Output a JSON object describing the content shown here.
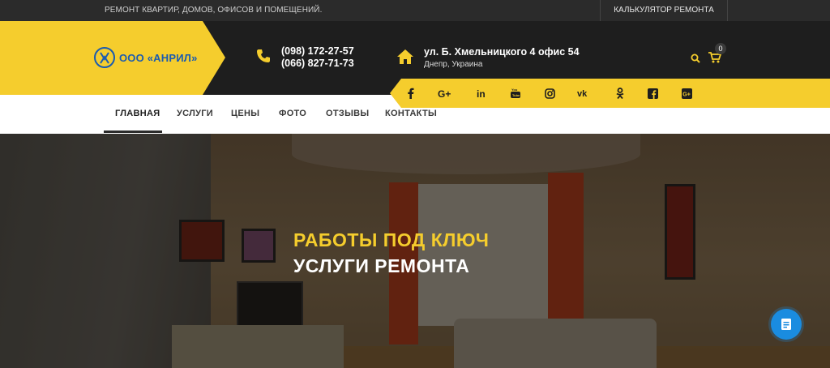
{
  "topbar": {
    "tagline": "РЕМОНТ КВАРТИР, ДОМОВ, ОФИСОВ И ПОМЕЩЕНИЙ.",
    "calc_link": "КАЛЬКУЛЯТОР РЕМОНТА"
  },
  "header": {
    "logo_text": "ООО «АНРИЛ»",
    "phones": [
      "(098) 172-27-57",
      "(066) 827-71-73"
    ],
    "address": "ул. Б. Хмельницкого 4 офис 54",
    "city": "Днепр, Украина",
    "cart_count": "0"
  },
  "social": [
    "facebook-icon",
    "google-plus-icon",
    "linkedin-icon",
    "youtube-icon",
    "instagram-icon",
    "vk-icon",
    "odnoklassniki-icon",
    "facebook-square-icon",
    "google-plus-square-icon"
  ],
  "nav": {
    "items": [
      "ГЛАВНАЯ",
      "УСЛУГИ",
      "ЦЕНЫ",
      "ФОТО",
      "ОТЗЫВЫ",
      "КОНТАКТЫ"
    ],
    "active_index": 0
  },
  "hero": {
    "title_line1": "РАБОТЫ ПОД КЛЮЧ",
    "title_line2": "УСЛУГИ РЕМОНТА"
  },
  "colors": {
    "accent": "#f5cd2d",
    "dark": "#1e1e1e",
    "chat": "#1a8ce0"
  }
}
